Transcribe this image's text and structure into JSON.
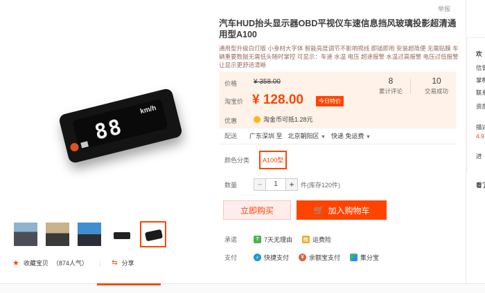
{
  "report": "举报",
  "product": {
    "title": "汽车HUD抬头显示器OBD平视仪车速信息挡风玻璃投影超清通用型A100",
    "subtitle": "通用型升级白灯版 小身材大字体 智能亮度调节不影响视线 即插即用 安装超简便 无需贴膜 车辆重要数据无需低头随时掌控 可显示：车速 水温 电压 超速报警 水温过高报警 电压过低报警 让显示更舒适清晰",
    "device_digits": "88",
    "device_unit": "km/h"
  },
  "price": {
    "label_price": "价格",
    "old_price": "¥ 358.00",
    "label_taobao": "淘宝价",
    "new_price": "¥ 128.00",
    "promo_tag": "今日特价",
    "label_discount": "优惠",
    "coin_text": "淘金币可抵1.28元"
  },
  "stats": {
    "reviews_count": "8",
    "reviews_label": "累计评论",
    "sales_count": "10",
    "sales_label": "交易成功"
  },
  "delivery": {
    "label": "配送",
    "from": "广东深圳 至",
    "to": "北京朝阳区",
    "method": "快递 免运费"
  },
  "variant": {
    "label": "颜色分类",
    "selected": "A100型"
  },
  "quantity": {
    "label": "数量",
    "minus": "−",
    "value": "1",
    "plus": "+",
    "stock": "件(库存120件)"
  },
  "actions": {
    "buy_now": "立即购买",
    "add_cart": "加入购物车"
  },
  "promise": {
    "label": "承诺",
    "items": [
      "7天无理由",
      "运费险"
    ]
  },
  "payment": {
    "label": "支付",
    "items": [
      "快捷支付",
      "余额宝支付",
      "集分宝"
    ]
  },
  "favorite": {
    "label": "收藏宝贝",
    "count": "（874人气）",
    "share": "分享"
  },
  "sidebar": {
    "items": [
      "欢",
      "信誉",
      "掌柜",
      "联系",
      "资质",
      "描述",
      "4.9",
      "进",
      "看了"
    ]
  },
  "colors": {
    "accent": "#ff4400",
    "price_bg": "#fff2e8"
  }
}
